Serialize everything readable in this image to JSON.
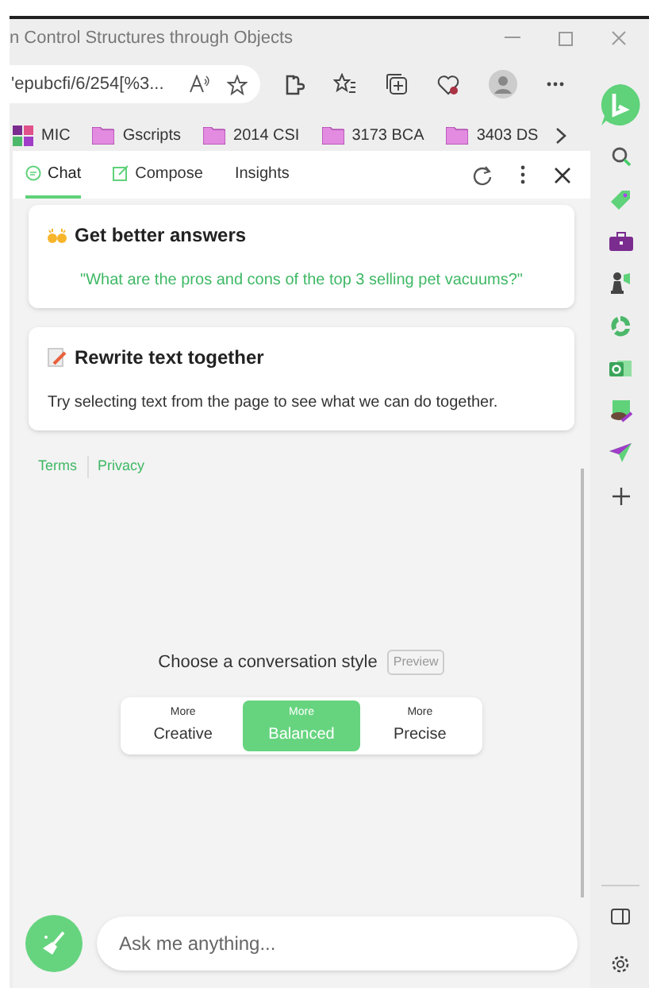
{
  "window": {
    "title": "n Control Structures through Objects"
  },
  "address_bar": {
    "url": "'epubcfi/6/254[%3..."
  },
  "bookmarks": [
    {
      "label": "MIC",
      "kind": "apps"
    },
    {
      "label": "Gscripts",
      "kind": "folder"
    },
    {
      "label": "2014 CSI",
      "kind": "folder"
    },
    {
      "label": "3173 BCA",
      "kind": "folder"
    },
    {
      "label": "3403 DS",
      "kind": "folder"
    }
  ],
  "panel_tabs": [
    {
      "label": "Chat",
      "selected": true
    },
    {
      "label": "Compose",
      "selected": false
    },
    {
      "label": "Insights",
      "selected": false
    }
  ],
  "cards": [
    {
      "title": "Get better answers",
      "body": "\"What are the pros and cons of the top 3 selling pet vacuums?\"",
      "kind": "example"
    },
    {
      "title": "Rewrite text together",
      "body": "Try selecting text from the page to see what we can do together.",
      "kind": "tip"
    }
  ],
  "footer_links": [
    "Terms",
    "Privacy"
  ],
  "style_chooser": {
    "label": "Choose a conversation style",
    "badge": "Preview",
    "options": [
      {
        "prefix": "More",
        "label": "Creative",
        "selected": false
      },
      {
        "prefix": "More",
        "label": "Balanced",
        "selected": true
      },
      {
        "prefix": "More",
        "label": "Precise",
        "selected": false
      }
    ]
  },
  "input": {
    "placeholder": "Ask me anything..."
  }
}
